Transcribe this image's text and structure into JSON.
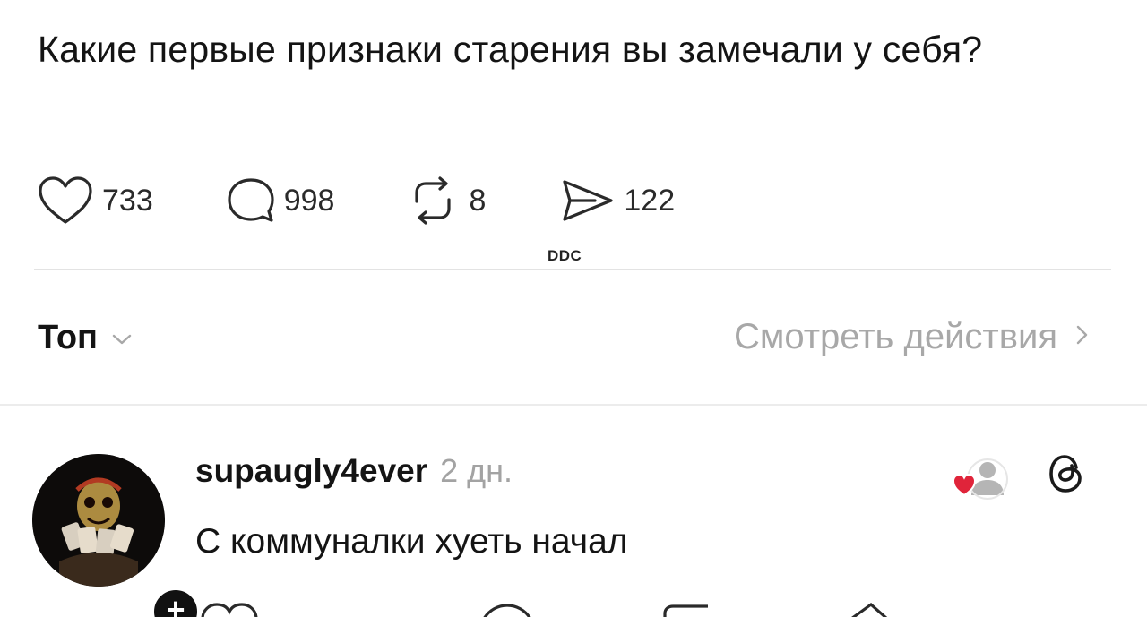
{
  "post": {
    "text": "Какие первые признаки старения вы замечали у себя?",
    "actions": {
      "likes": "733",
      "comments": "998",
      "reposts": "8",
      "shares": "122"
    },
    "watermark": "DDC"
  },
  "sort": {
    "label": "Топ",
    "view_activity": "Смотреть действия"
  },
  "reply": {
    "username": "supaugly4ever",
    "time": "2 дн.",
    "text": "С коммуналки хуеть начал"
  },
  "colors": {
    "text": "#141414",
    "muted": "#a3a3a3",
    "heart_red": "#e0243a"
  }
}
